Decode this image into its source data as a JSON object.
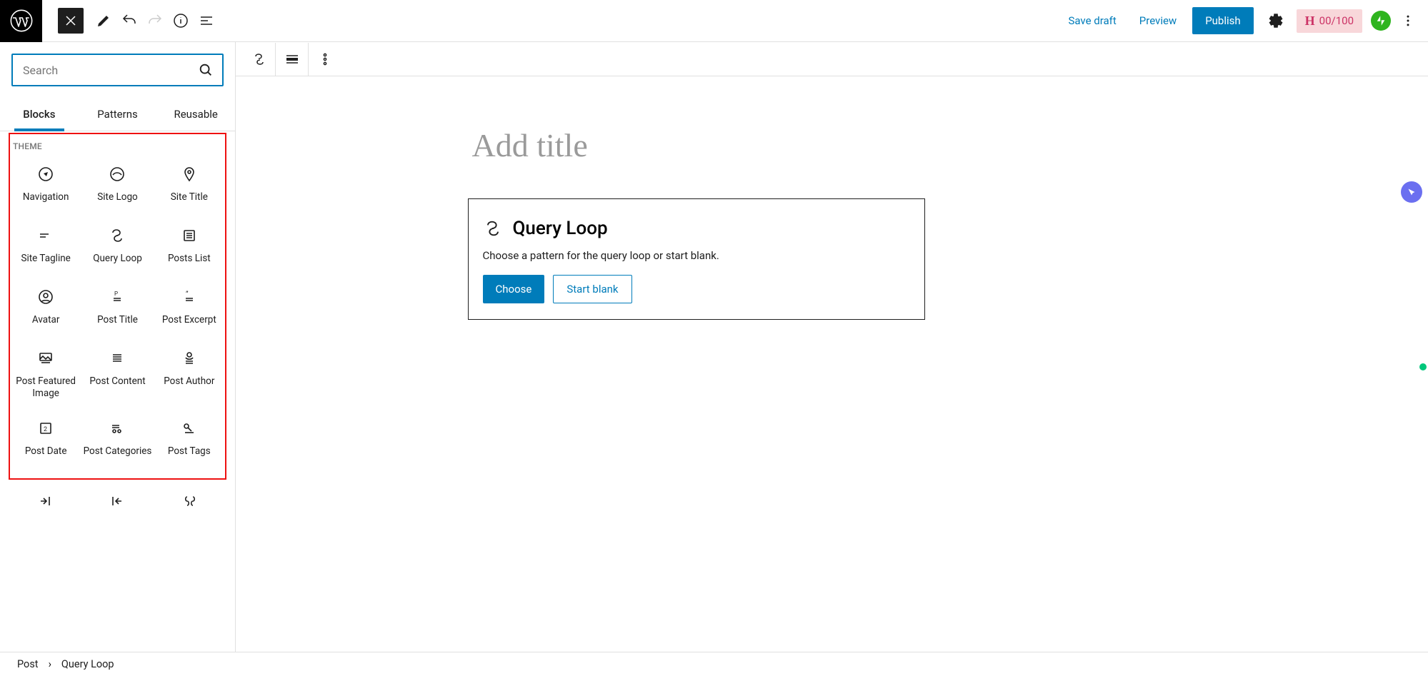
{
  "topbar": {
    "save_draft": "Save draft",
    "preview": "Preview",
    "publish": "Publish",
    "h_score": "00/100"
  },
  "inserter": {
    "search_placeholder": "Search",
    "tabs": {
      "blocks": "Blocks",
      "patterns": "Patterns",
      "reusable": "Reusable"
    },
    "section_label": "THEME",
    "blocks": [
      {
        "label": "Navigation",
        "icon": "compass"
      },
      {
        "label": "Site Logo",
        "icon": "sitelogo"
      },
      {
        "label": "Site Title",
        "icon": "pin"
      },
      {
        "label": "Site Tagline",
        "icon": "tagline"
      },
      {
        "label": "Query Loop",
        "icon": "loop"
      },
      {
        "label": "Posts List",
        "icon": "postslist"
      },
      {
        "label": "Avatar",
        "icon": "avatar"
      },
      {
        "label": "Post Title",
        "icon": "posttitle"
      },
      {
        "label": "Post Excerpt",
        "icon": "excerpt"
      },
      {
        "label": "Post Featured Image",
        "icon": "featimg"
      },
      {
        "label": "Post Content",
        "icon": "content"
      },
      {
        "label": "Post Author",
        "icon": "author"
      },
      {
        "label": "Post Date",
        "icon": "date"
      },
      {
        "label": "Post Categories",
        "icon": "categories"
      },
      {
        "label": "Post Tags",
        "icon": "tags"
      }
    ],
    "next_row_icons": [
      "next",
      "prev",
      "pagenum"
    ]
  },
  "editor": {
    "title_placeholder": "Add title",
    "query_loop": {
      "heading": "Query Loop",
      "description": "Choose a pattern for the query loop or start blank.",
      "choose": "Choose",
      "start_blank": "Start blank"
    }
  },
  "footer": {
    "crumb1": "Post",
    "crumb2": "Query Loop"
  }
}
